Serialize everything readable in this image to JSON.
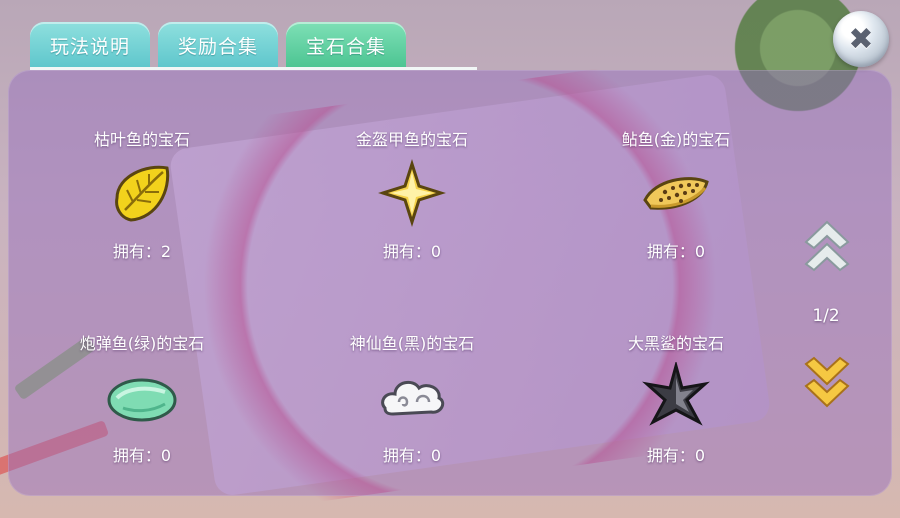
{
  "tabs": [
    {
      "label": "玩法说明",
      "active": false
    },
    {
      "label": "奖励合集",
      "active": false
    },
    {
      "label": "宝石合集",
      "active": true
    }
  ],
  "close_button": {
    "icon": "close-icon"
  },
  "gems": [
    {
      "name": "枯叶鱼的宝石",
      "owned": "拥有：2",
      "icon": "yellow-leaf-gem-icon"
    },
    {
      "name": "金盔甲鱼的宝石",
      "owned": "拥有：0",
      "icon": "gold-star-gem-icon"
    },
    {
      "name": "鲇鱼(金)的宝石",
      "owned": "拥有：0",
      "icon": "spotted-gold-gem-icon"
    },
    {
      "name": "炮弹鱼(绿)的宝石",
      "owned": "拥有：0",
      "icon": "green-oval-gem-icon"
    },
    {
      "name": "神仙鱼(黑)的宝石",
      "owned": "拥有：0",
      "icon": "white-cloud-gem-icon"
    },
    {
      "name": "大黑鲨的宝石",
      "owned": "拥有：0",
      "icon": "dark-star-gem-icon"
    }
  ],
  "pager": {
    "indicator": "1/2",
    "up_icon": "double-chevron-up-icon",
    "down_icon": "double-chevron-down-icon"
  },
  "colors": {
    "tab": "#6fd3d4",
    "tab_active": "#5ccb9e",
    "panel": "#9a70be",
    "page_down": "#f5c842"
  }
}
